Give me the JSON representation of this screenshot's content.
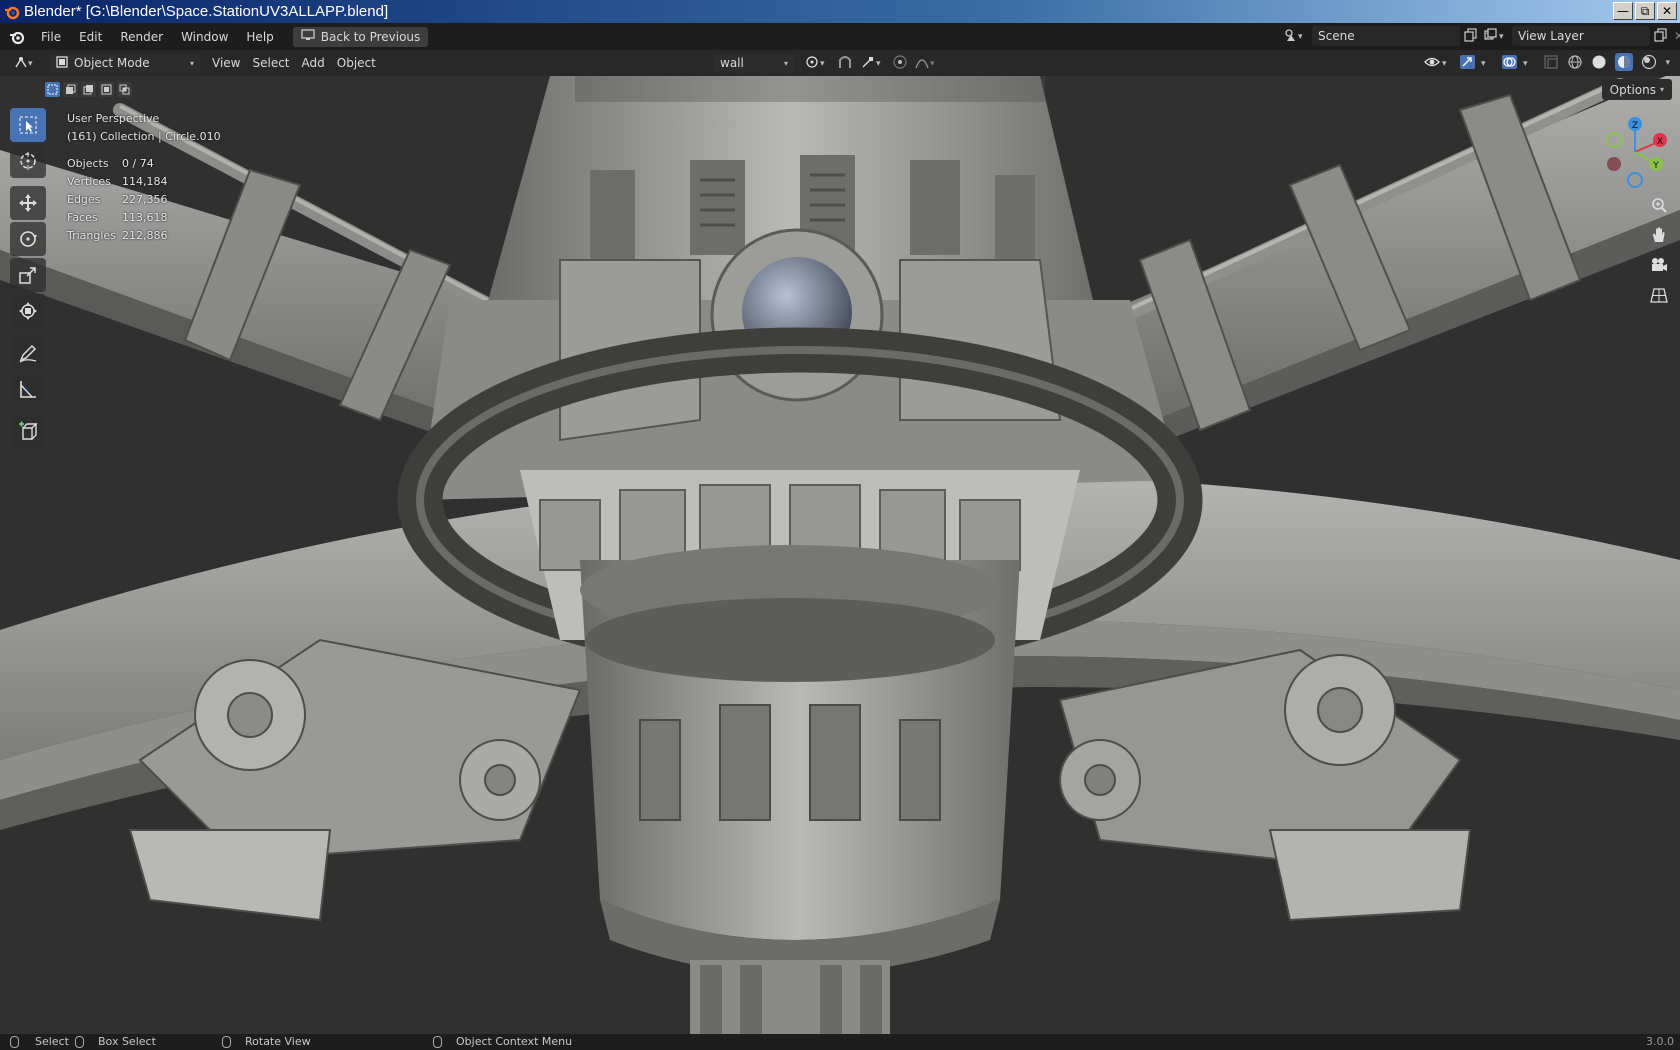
{
  "window": {
    "title": "Blender* [G:\\Blender\\Space.StationUV3ALLAPP.blend]",
    "buttons": [
      "minimize-icon",
      "restore-icon",
      "close-icon"
    ]
  },
  "menubar": {
    "items": [
      "File",
      "Edit",
      "Render",
      "Window",
      "Help"
    ],
    "back_button": "Back to Previous",
    "scene": "Scene",
    "view_layer": "View Layer"
  },
  "header": {
    "mode": "Object Mode",
    "menus": [
      "View",
      "Select",
      "Add",
      "Object"
    ],
    "material_slot": "wall",
    "options_label": "Options"
  },
  "viewport": {
    "view_name": "User Perspective",
    "collection_info": "(161) Collection | Circle.010",
    "stats": [
      {
        "label": "Objects",
        "value": "0 / 74"
      },
      {
        "label": "Vertices",
        "value": "114,184"
      },
      {
        "label": "Edges",
        "value": "227,356"
      },
      {
        "label": "Faces",
        "value": "113,618"
      },
      {
        "label": "Triangles",
        "value": "212,886"
      }
    ],
    "gizmo_axes": [
      "Z",
      "X",
      "Y"
    ]
  },
  "toolbar": {
    "tools": [
      "select-box-icon",
      "cursor-icon",
      "move-icon",
      "rotate-icon",
      "scale-icon",
      "transform-icon",
      "annotate-icon",
      "measure-icon",
      "add-cube-icon"
    ]
  },
  "statusbar": {
    "items": [
      "Select",
      "Box Select",
      "Rotate View",
      "Object Context Menu"
    ],
    "version": "3.0.0"
  },
  "colors": {
    "accent": "#4772b3",
    "background": "#303030",
    "axis_x": "#e0364d",
    "axis_y": "#8bc34a",
    "axis_z": "#3b8fe0"
  }
}
